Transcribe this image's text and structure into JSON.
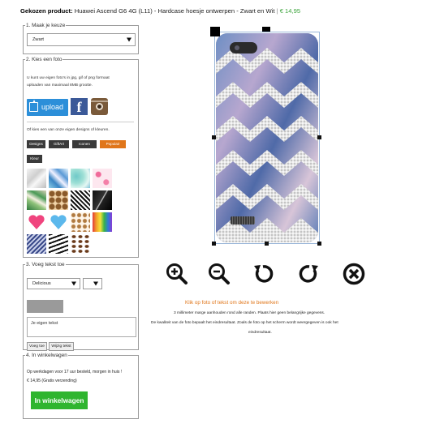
{
  "header": {
    "label": "Gekozen product:",
    "product": "Huawei Ascend G6 4G (L11) - Hardcase hoesje ontwerpen - Zwart en Wit",
    "separator": "|",
    "price": "€ 14,95"
  },
  "step1": {
    "legend": "1. Maak je keuze",
    "color_select": "Zwart"
  },
  "step2": {
    "legend": "2. Kies een foto",
    "info_line1": "U kunt uw eigen foto's in jpg, gif of png formaat",
    "info_line2": "uploaden van maximaal 8MB grootte.",
    "upload_label": "upload",
    "facebook_label": "f",
    "design_note": "Of kies een van onze eigen designs of kleuren.",
    "categories": [
      "Designs",
      "GiftArt",
      "Iconen",
      "Populair",
      "Kleur"
    ],
    "active_category": "Populair",
    "designs": [
      "marble-white",
      "crystal-blue",
      "watercolor-teal",
      "flamingo-pink",
      "tropical-leaves",
      "giraffe-pattern",
      "chevron-black",
      "marble-black",
      "hearts-pink",
      "blue-heart",
      "cookies-pattern",
      "paint-drips",
      "chevron-blue",
      "stripes-black",
      "coffee-beans"
    ]
  },
  "step3": {
    "legend": "3. Voeg tekst toe",
    "font_select": "Delicious",
    "text_value": "Je eigen tekst",
    "add_button": "Voeg toe",
    "edit_button": "Wijzig tekst"
  },
  "step4": {
    "legend": "4. In winkelwagen",
    "delivery": "Op werkdagen voor 17 uur besteld, morgen in huis !",
    "price_line": "€ 14,95 (Gratis verzending)",
    "cart_button": "In winkelwagen"
  },
  "editor": {
    "tools": [
      "zoom-in-icon",
      "zoom-out-icon",
      "rotate-left-icon",
      "rotate-right-icon",
      "delete-icon"
    ],
    "edit_hint": "Klik op foto of tekst om deze te bewerken",
    "note_margin": "3 millimeter marge aanhouden rond alle randen. Plaats hier geen belangrijke gegevens.",
    "note_quality_1": "De kwaliteit van de foto bepaalt het eindresultaat. Zoals de foto op het scherm wordt weergegeven is ook het",
    "note_quality_2": "eindresultaat."
  },
  "colors": {
    "price_green": "#3aa33a",
    "accent_orange": "#e0761a",
    "upload_blue": "#2c8fd9",
    "cart_green": "#2fb52f",
    "facebook_blue": "#3b5998"
  }
}
